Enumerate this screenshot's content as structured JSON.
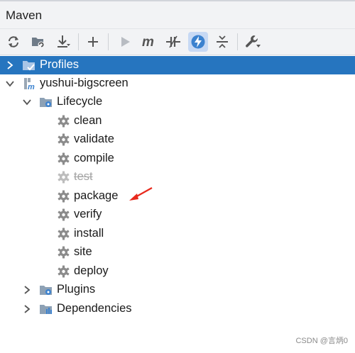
{
  "panel": {
    "title": "Maven"
  },
  "toolbar": {
    "buttons": [
      {
        "name": "reload-all-maven-projects",
        "icon": "refresh-icon"
      },
      {
        "name": "generate-sources",
        "icon": "folder-refresh-icon"
      },
      {
        "name": "download-sources",
        "icon": "download-icon"
      },
      {
        "name": "add-maven-project",
        "icon": "plus-icon"
      },
      {
        "name": "run-maven-build",
        "icon": "run-icon"
      },
      {
        "name": "execute-maven-goal",
        "icon": "m-icon"
      },
      {
        "name": "toggle-offline-mode",
        "icon": "offline-icon"
      },
      {
        "name": "toggle-skip-tests",
        "icon": "lightning-icon",
        "active": true
      },
      {
        "name": "collapse-all",
        "icon": "collapse-icon"
      },
      {
        "name": "maven-settings",
        "icon": "wrench-icon"
      }
    ]
  },
  "tree": {
    "profiles": "Profiles",
    "project": "yushui-bigscreen",
    "lifecycle": "Lifecycle",
    "goals": [
      "clean",
      "validate",
      "compile",
      "test",
      "package",
      "verify",
      "install",
      "site",
      "deploy"
    ],
    "skipped_goal": "test",
    "plugins": "Plugins",
    "dependencies": "Dependencies"
  },
  "watermark": "CSDN @言炳0",
  "colors": {
    "selection": "#2675bf",
    "gear": "#8c8c8c",
    "folder": "#8da1b5",
    "active_toggle": "#c7d9f4",
    "annotation_arrow": "#e8291c"
  }
}
